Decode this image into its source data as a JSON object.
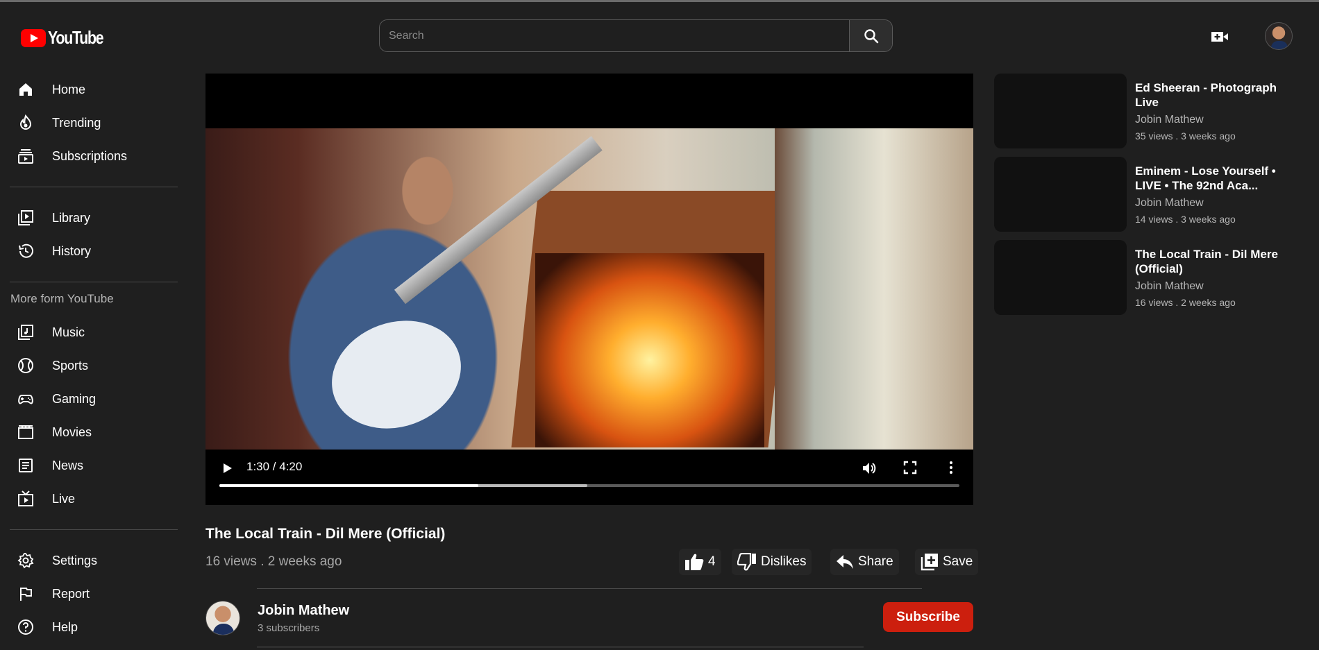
{
  "app": {
    "logo_text": "YouTube"
  },
  "search": {
    "placeholder": "Search"
  },
  "sidebar": {
    "group1": [
      {
        "label": "Home",
        "icon": "home-icon"
      },
      {
        "label": "Trending",
        "icon": "trending-icon"
      },
      {
        "label": "Subscriptions",
        "icon": "subscriptions-icon"
      }
    ],
    "group2": [
      {
        "label": "Library",
        "icon": "library-icon"
      },
      {
        "label": "History",
        "icon": "history-icon"
      }
    ],
    "section_title": "More form YouTube",
    "group3": [
      {
        "label": "Music",
        "icon": "music-icon"
      },
      {
        "label": "Sports",
        "icon": "sports-icon"
      },
      {
        "label": "Gaming",
        "icon": "gaming-icon"
      },
      {
        "label": "Movies",
        "icon": "movies-icon"
      },
      {
        "label": "News",
        "icon": "news-icon"
      },
      {
        "label": "Live",
        "icon": "live-icon"
      }
    ],
    "group4": [
      {
        "label": "Settings",
        "icon": "settings-icon"
      },
      {
        "label": "Report",
        "icon": "report-icon"
      },
      {
        "label": "Help",
        "icon": "help-icon"
      }
    ]
  },
  "player": {
    "time": "1:30 / 4:20",
    "played_fraction": 0.35,
    "buffered_fraction": 0.497
  },
  "video": {
    "title": "The Local Train - Dil Mere (Official)",
    "meta": "16 views . 2 weeks ago",
    "likes": "4",
    "dislikes_label": "Dislikes",
    "share_label": "Share",
    "save_label": "Save"
  },
  "channel": {
    "name": "Jobin Mathew",
    "subscribers": "3 subscribers",
    "subscribe_label": "Subscribe"
  },
  "recommendations": [
    {
      "title": "Ed Sheeran - Photograph Live",
      "channel": "Jobin Mathew",
      "meta": "35 views . 3 weeks ago"
    },
    {
      "title": "Eminem - Lose Yourself • LIVE • The 92nd Aca...",
      "channel": "Jobin Mathew",
      "meta": "14 views . 3 weeks ago"
    },
    {
      "title": "The Local Train - Dil Mere (Official)",
      "channel": "Jobin Mathew",
      "meta": "16 views . 2 weeks ago"
    }
  ],
  "colors": {
    "background": "#1f1f1f",
    "subscribe": "#cc1f0e",
    "logo_red": "#ff0000"
  }
}
